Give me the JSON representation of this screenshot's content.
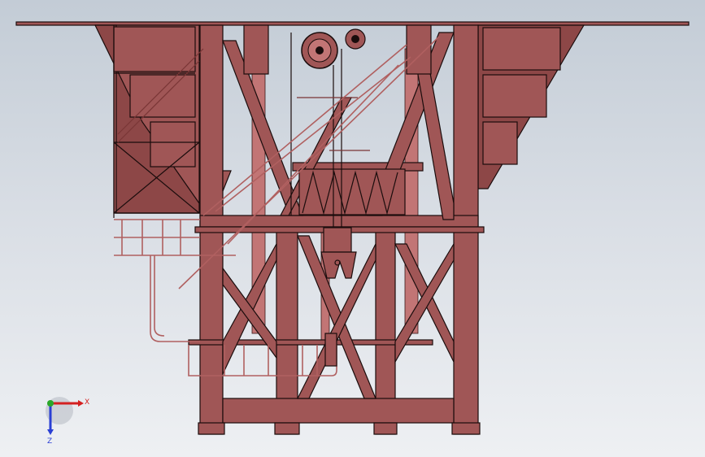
{
  "viewport": {
    "background_top": "#c3ccd6",
    "background_bottom": "#eef0f3"
  },
  "model": {
    "steel_color": "#a05656",
    "edge_color": "#1a0c0c"
  },
  "triad": {
    "x_label": "X",
    "z_label": "Z",
    "x_color": "#d42020",
    "y_color": "#2aa82a",
    "z_color": "#2a3fd4"
  }
}
